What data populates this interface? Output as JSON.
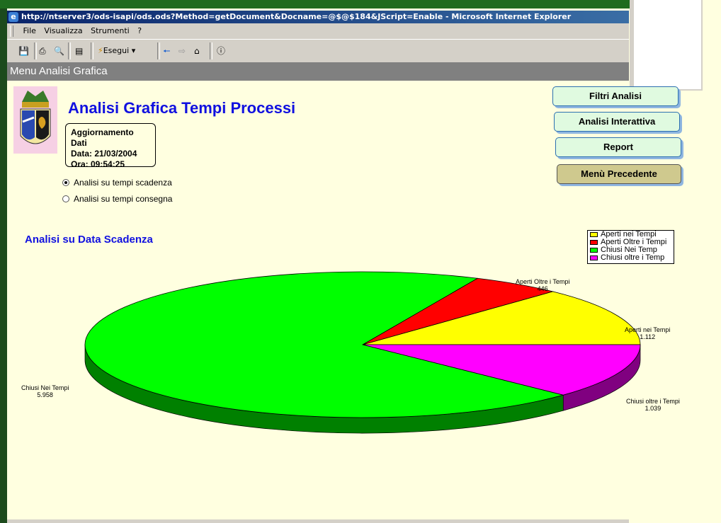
{
  "window": {
    "title": "http://ntserver3/ods-isapi/ods.ods?Method=getDocument&Docname=@$@$184&JScript=Enable - Microsoft Internet Explorer"
  },
  "menubar": {
    "items": [
      "File",
      "Visualizza",
      "Strumenti",
      "?"
    ]
  },
  "toolbar": {
    "run_label": "Esegui"
  },
  "page_header": "Menu Analisi Grafica",
  "page_title": "Analisi Grafica Tempi Processi",
  "update_box": {
    "heading": "Aggiornamento Dati",
    "date": "Data: 21/03/2004",
    "time": "Ora: 09:54:25"
  },
  "radios": [
    {
      "label": "Analisi su tempi scadenza",
      "selected": true
    },
    {
      "label": "Analisi su tempi consegna",
      "selected": false
    }
  ],
  "buttons": {
    "filtri": "Filtri Analisi",
    "interattiva": "Analisi Interattiva",
    "report": "Report",
    "precedente": "Menù Precedente"
  },
  "section_title": "Analisi su Data Scadenza",
  "chart_data": {
    "type": "pie",
    "title": "Analisi su Data Scadenza",
    "slices": [
      {
        "name": "Aperti nei Tempi",
        "value": 1112,
        "label": "1.112",
        "color": "#ffff00"
      },
      {
        "name": "Aperti Oltre i Tempi",
        "value": 446,
        "label": "446",
        "color": "#ff0000"
      },
      {
        "name": "Chiusi Nei Tempi",
        "value": 5958,
        "label": "5.958",
        "color": "#00ff00"
      },
      {
        "name": "Chiusi oltre i Tempi",
        "value": 1039,
        "label": "1.039",
        "color": "#ff00ff"
      }
    ],
    "legend": {
      "placement": "top-right",
      "entries": [
        "Aperti nei Tempi",
        "Aperti Oltre i Tempi",
        "Chiusi Nei Temp",
        "Chiusi oltre i Temp"
      ]
    }
  }
}
